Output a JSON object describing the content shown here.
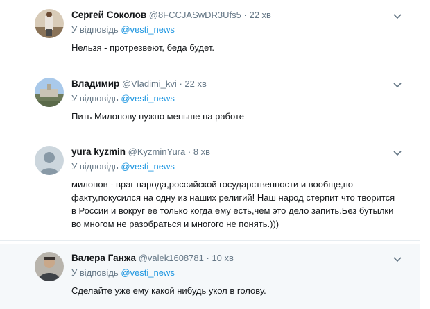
{
  "tweets": [
    {
      "name": "Сергей Соколов",
      "handle": "@8FCCJASwDR3Ufs5",
      "dot": "·",
      "time": "22 хв",
      "reply_prefix": "У відповідь",
      "reply_to": "@vesti_news",
      "text": "Нельзя - протрезвеют, беда будет."
    },
    {
      "name": "Владимир",
      "handle": "@Vladimi_kvi",
      "dot": "·",
      "time": "22 хв",
      "reply_prefix": "У відповідь",
      "reply_to": "@vesti_news",
      "text": "Пить Милонову нужно меньше на работе"
    },
    {
      "name": "yura kyzmin",
      "handle": "@KyzminYura",
      "dot": "·",
      "time": "8 хв",
      "reply_prefix": "У відповідь",
      "reply_to": "@vesti_news",
      "text_lines": [
        "милонов - враг народа,российской государственности  и вообще,по",
        "факту,покусился на одну из наших религий! Наш народ стерпит что творится",
        "в России и вокруг ее только когда ему есть,чем это дело запить.Без бутылки",
        "во многом не разобраться и многого не понять.)))"
      ]
    },
    {
      "name": "Валера Ганжа",
      "handle": "@valek1608781",
      "dot": "·",
      "time": "10 хв",
      "reply_prefix": "У відповідь",
      "reply_to": "@vesti_news",
      "text": "Сделайте уже ему какой нибудь укол в голову."
    }
  ],
  "icons": {
    "menu": "chevron-down-icon",
    "default_avatar": "user-silhouette-icon"
  },
  "colors": {
    "link": "#1b95e0",
    "muted": "#657786",
    "highlight_bg": "#f5f8fa",
    "separator": "#e6ecf0"
  }
}
